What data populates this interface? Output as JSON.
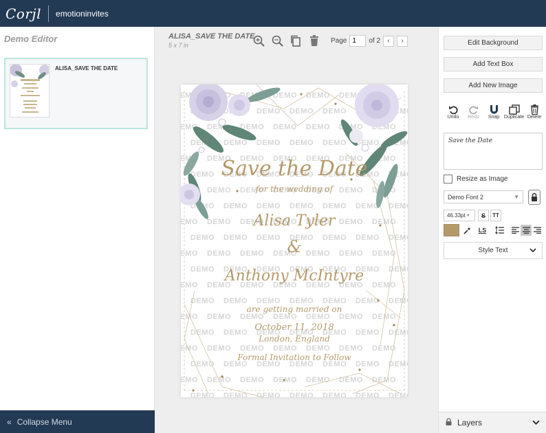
{
  "app": {
    "logo": "Corjl",
    "brand": "emotioninvites"
  },
  "left_panel": {
    "title": "Demo Editor",
    "templates": [
      {
        "name": "ALISA_SAVE THE DATE"
      }
    ],
    "collapse_label": "Collapse Menu"
  },
  "canvas": {
    "doc_title": "ALISA_SAVE THE DATE",
    "doc_size": "5 x 7 in",
    "page_label": "Page",
    "page_value": "1",
    "page_total": "of 2",
    "watermark": "DEMO"
  },
  "card": {
    "title": "Save the Date",
    "line1": "for the wedding of",
    "name1": "Alisa Tyler",
    "amp": "&",
    "name2": "Anthony McIntyre",
    "line2": "are getting married on",
    "date": "October 11, 2018",
    "place": "London, England",
    "footer": "Formal Invitation to Follow"
  },
  "right_panel": {
    "edit_background": "Edit Background",
    "add_text_box": "Add Text Box",
    "add_new_image": "Add New Image",
    "actions": [
      {
        "label": "Undo",
        "icon": "undo-icon"
      },
      {
        "label": "Redo",
        "icon": "redo-icon"
      },
      {
        "label": "Snap",
        "icon": "magnet-icon"
      },
      {
        "label": "Duplicate",
        "icon": "duplicate-icon"
      },
      {
        "label": "Delete",
        "icon": "trash-icon"
      }
    ],
    "text_value": "Save the Date",
    "resize_label": "Resize as Image",
    "font_value": "Demo Font 2",
    "font_size": "46.33pt",
    "text_color": "#b49a6b",
    "style_text": "Style Text",
    "layers": "Layers"
  },
  "colors": {
    "topbar": "#233a54",
    "accent_gold": "#b49a6b",
    "selection": "#b9e4dc"
  }
}
